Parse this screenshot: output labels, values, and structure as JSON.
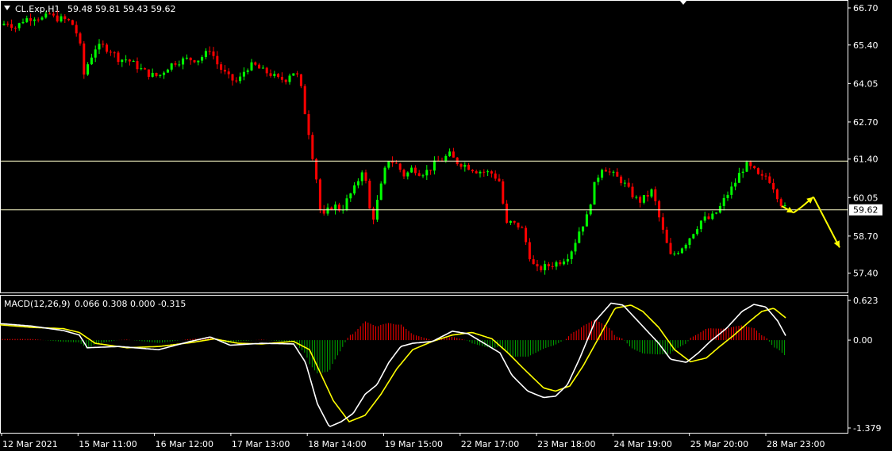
{
  "header": {
    "symbol": "CL.Exp,H1",
    "ohlc": "59.48 59.81 59.43 59.62",
    "macd_label": "MACD(12,26,9)",
    "macd_values": "0.066 0.308 0.000 -0.315"
  },
  "colors": {
    "background": "#000000",
    "frame": "#ffffff",
    "bull": "#00ff00",
    "bear": "#ff0000",
    "hline": "#ffffcc",
    "arrow": "#ffff00",
    "macd_main": "#ffffff",
    "macd_signal": "#ffff00",
    "hist_pos": "#ff0000",
    "hist_neg": "#00aa00"
  },
  "chart_data": {
    "type": "candlestick",
    "title": "CL.Exp,H1",
    "price_axis": {
      "ticks": [
        "66.70",
        "65.40",
        "64.05",
        "62.70",
        "61.40",
        "60.05",
        "58.70",
        "57.40"
      ],
      "range": [
        56.75,
        66.95
      ],
      "current_price_label": "59.62"
    },
    "time_axis": {
      "labels": [
        "12 Mar 2021",
        "15 Mar 11:00",
        "16 Mar 12:00",
        "17 Mar 13:00",
        "18 Mar 14:00",
        "19 Mar 15:00",
        "22 Mar 17:00",
        "23 Mar 18:00",
        "24 Mar 19:00",
        "25 Mar 20:00",
        "28 Mar 23:00"
      ]
    },
    "horizontal_lines": [
      61.33,
      59.62
    ],
    "price_path_anchors": [
      [
        0,
        66.1
      ],
      [
        10,
        66.2
      ],
      [
        20,
        66.0
      ],
      [
        30,
        66.3
      ],
      [
        45,
        66.4
      ],
      [
        55,
        66.3
      ],
      [
        62,
        66.5
      ],
      [
        68,
        66.35
      ],
      [
        80,
        66.3
      ],
      [
        90,
        66.2
      ],
      [
        100,
        65.6
      ],
      [
        105,
        64.3
      ],
      [
        110,
        64.7
      ],
      [
        120,
        65.3
      ],
      [
        130,
        65.35
      ],
      [
        140,
        65.2
      ],
      [
        150,
        64.9
      ],
      [
        160,
        64.9
      ],
      [
        170,
        64.7
      ],
      [
        180,
        64.5
      ],
      [
        190,
        64.35
      ],
      [
        200,
        64.3
      ],
      [
        210,
        64.6
      ],
      [
        220,
        64.8
      ],
      [
        235,
        64.9
      ],
      [
        250,
        64.9
      ],
      [
        260,
        65.1
      ],
      [
        265,
        65.3
      ],
      [
        272,
        64.8
      ],
      [
        280,
        64.5
      ],
      [
        290,
        64.2
      ],
      [
        300,
        64.1
      ],
      [
        310,
        64.6
      ],
      [
        320,
        64.7
      ],
      [
        330,
        64.5
      ],
      [
        340,
        64.4
      ],
      [
        350,
        64.2
      ],
      [
        360,
        64.2
      ],
      [
        368,
        64.5
      ],
      [
        375,
        64.3
      ],
      [
        380,
        63.8
      ],
      [
        385,
        62.9
      ],
      [
        390,
        62.2
      ],
      [
        395,
        61.3
      ],
      [
        400,
        60.5
      ],
      [
        405,
        59.2
      ],
      [
        410,
        59.5
      ],
      [
        420,
        59.8
      ],
      [
        430,
        59.6
      ],
      [
        440,
        60.1
      ],
      [
        450,
        60.5
      ],
      [
        455,
        61.1
      ],
      [
        460,
        60.8
      ],
      [
        465,
        59.7
      ],
      [
        470,
        59.3
      ],
      [
        478,
        60.2
      ],
      [
        485,
        61.0
      ],
      [
        490,
        61.4
      ],
      [
        500,
        61.2
      ],
      [
        510,
        60.8
      ],
      [
        520,
        61.1
      ],
      [
        530,
        60.9
      ],
      [
        540,
        61.0
      ],
      [
        550,
        61.3
      ],
      [
        560,
        61.4
      ],
      [
        565,
        61.6
      ],
      [
        575,
        61.3
      ],
      [
        585,
        61.2
      ],
      [
        600,
        61.0
      ],
      [
        620,
        60.9
      ],
      [
        630,
        60.6
      ],
      [
        635,
        59.6
      ],
      [
        640,
        58.9
      ],
      [
        645,
        59.3
      ],
      [
        650,
        59.0
      ],
      [
        655,
        59.1
      ],
      [
        660,
        58.8
      ],
      [
        665,
        58.2
      ],
      [
        670,
        57.8
      ],
      [
        675,
        57.5
      ],
      [
        685,
        57.6
      ],
      [
        695,
        57.7
      ],
      [
        705,
        57.8
      ],
      [
        715,
        58.0
      ],
      [
        722,
        58.3
      ],
      [
        730,
        58.9
      ],
      [
        740,
        59.4
      ],
      [
        748,
        60.4
      ],
      [
        755,
        60.9
      ],
      [
        760,
        61.2
      ],
      [
        765,
        61.0
      ],
      [
        775,
        60.8
      ],
      [
        785,
        60.6
      ],
      [
        795,
        60.2
      ],
      [
        805,
        59.9
      ],
      [
        815,
        60.1
      ],
      [
        822,
        60.3
      ],
      [
        830,
        59.4
      ],
      [
        838,
        58.6
      ],
      [
        845,
        58.0
      ],
      [
        855,
        58.2
      ],
      [
        865,
        58.5
      ],
      [
        875,
        58.9
      ],
      [
        885,
        59.3
      ],
      [
        895,
        59.3
      ],
      [
        905,
        59.6
      ],
      [
        915,
        60.1
      ],
      [
        925,
        60.5
      ],
      [
        932,
        60.9
      ],
      [
        940,
        61.2
      ],
      [
        950,
        61.0
      ],
      [
        958,
        60.7
      ],
      [
        965,
        60.8
      ],
      [
        972,
        60.6
      ],
      [
        978,
        60.2
      ],
      [
        985,
        59.8
      ],
      [
        990,
        59.65
      ]
    ],
    "arrow_path": [
      [
        985,
        59.75
      ],
      [
        1000,
        59.52
      ],
      [
        1010,
        59.72
      ],
      [
        1025,
        60.07
      ],
      [
        1058,
        58.3
      ]
    ],
    "macd": {
      "label": "MACD(12,26,9)",
      "axis_ticks": [
        "0.623",
        "0.00",
        "-1.379"
      ],
      "range": [
        -1.379,
        0.623
      ],
      "main_anchors": [
        [
          0,
          0.26
        ],
        [
          40,
          0.22
        ],
        [
          80,
          0.15
        ],
        [
          100,
          0.08
        ],
        [
          110,
          -0.12
        ],
        [
          150,
          -0.1
        ],
        [
          200,
          -0.15
        ],
        [
          240,
          -0.02
        ],
        [
          265,
          0.05
        ],
        [
          290,
          -0.08
        ],
        [
          330,
          -0.05
        ],
        [
          370,
          -0.06
        ],
        [
          385,
          -0.35
        ],
        [
          400,
          -1.0
        ],
        [
          415,
          -1.36
        ],
        [
          430,
          -1.28
        ],
        [
          445,
          -1.15
        ],
        [
          460,
          -0.85
        ],
        [
          475,
          -0.7
        ],
        [
          490,
          -0.35
        ],
        [
          505,
          -0.1
        ],
        [
          520,
          -0.05
        ],
        [
          545,
          -0.02
        ],
        [
          570,
          0.14
        ],
        [
          590,
          0.1
        ],
        [
          610,
          -0.05
        ],
        [
          630,
          -0.2
        ],
        [
          645,
          -0.55
        ],
        [
          665,
          -0.8
        ],
        [
          685,
          -0.9
        ],
        [
          700,
          -0.88
        ],
        [
          715,
          -0.7
        ],
        [
          730,
          -0.3
        ],
        [
          750,
          0.3
        ],
        [
          770,
          0.58
        ],
        [
          785,
          0.55
        ],
        [
          800,
          0.35
        ],
        [
          815,
          0.15
        ],
        [
          830,
          -0.05
        ],
        [
          845,
          -0.3
        ],
        [
          865,
          -0.35
        ],
        [
          880,
          -0.2
        ],
        [
          895,
          -0.02
        ],
        [
          915,
          0.18
        ],
        [
          935,
          0.45
        ],
        [
          950,
          0.56
        ],
        [
          965,
          0.52
        ],
        [
          980,
          0.3
        ],
        [
          990,
          0.07
        ]
      ],
      "signal_anchors": [
        [
          0,
          0.24
        ],
        [
          40,
          0.2
        ],
        [
          80,
          0.18
        ],
        [
          100,
          0.12
        ],
        [
          120,
          -0.05
        ],
        [
          160,
          -0.12
        ],
        [
          200,
          -0.1
        ],
        [
          240,
          -0.04
        ],
        [
          270,
          0.02
        ],
        [
          300,
          -0.05
        ],
        [
          330,
          -0.06
        ],
        [
          370,
          -0.02
        ],
        [
          390,
          -0.15
        ],
        [
          405,
          -0.55
        ],
        [
          420,
          -0.95
        ],
        [
          440,
          -1.28
        ],
        [
          460,
          -1.18
        ],
        [
          480,
          -0.85
        ],
        [
          500,
          -0.45
        ],
        [
          520,
          -0.15
        ],
        [
          545,
          -0.02
        ],
        [
          570,
          0.08
        ],
        [
          595,
          0.12
        ],
        [
          620,
          0.02
        ],
        [
          640,
          -0.2
        ],
        [
          660,
          -0.45
        ],
        [
          685,
          -0.75
        ],
        [
          700,
          -0.8
        ],
        [
          718,
          -0.72
        ],
        [
          735,
          -0.4
        ],
        [
          755,
          0.05
        ],
        [
          775,
          0.5
        ],
        [
          795,
          0.55
        ],
        [
          810,
          0.45
        ],
        [
          830,
          0.2
        ],
        [
          850,
          -0.15
        ],
        [
          870,
          -0.34
        ],
        [
          890,
          -0.28
        ],
        [
          905,
          -0.12
        ],
        [
          925,
          0.08
        ],
        [
          945,
          0.3
        ],
        [
          960,
          0.45
        ],
        [
          975,
          0.5
        ],
        [
          990,
          0.35
        ]
      ]
    },
    "price_axis_label": "",
    "time_axis_label": ""
  }
}
